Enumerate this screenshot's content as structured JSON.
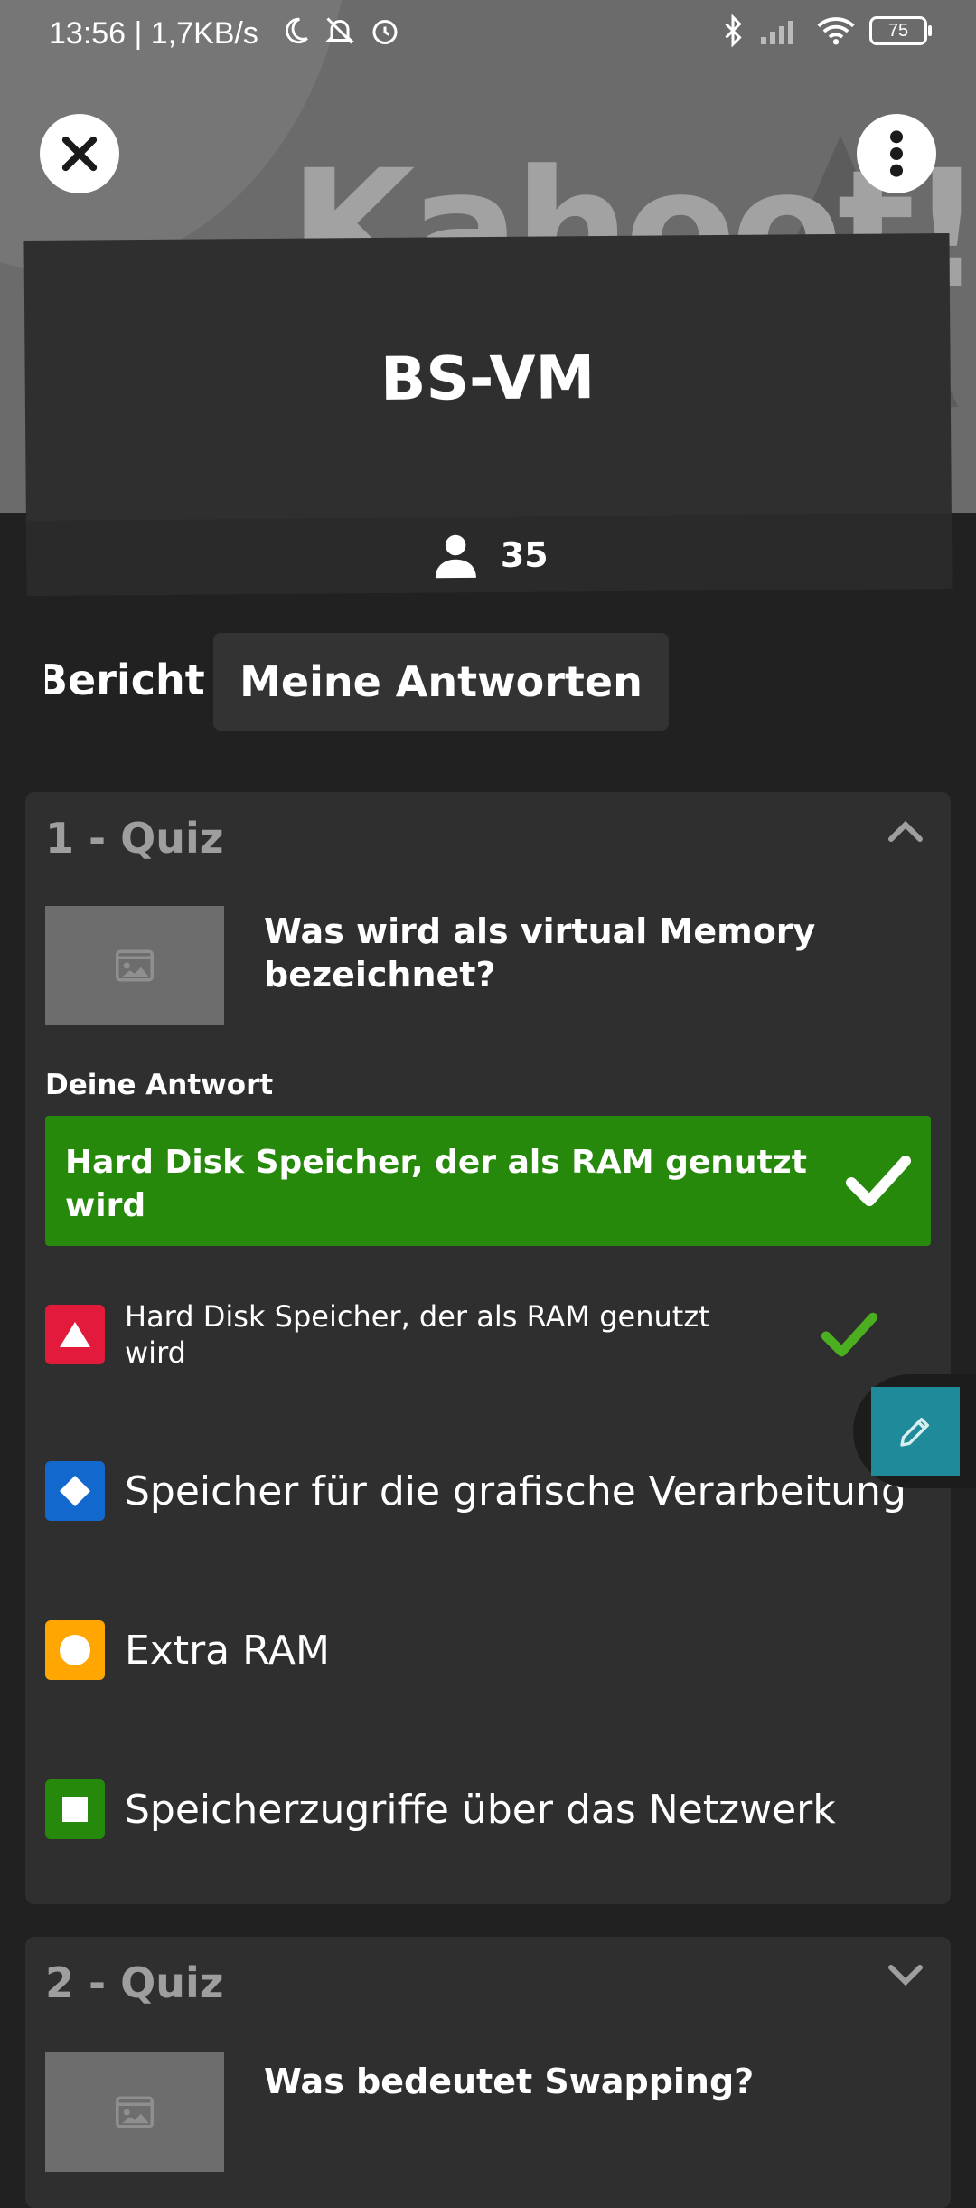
{
  "status_bar": {
    "time": "13:56 | 1,7KB/s",
    "battery": "75"
  },
  "header": {
    "logo_text": "Kahoot!",
    "title": "BS-VM",
    "player_count": "35"
  },
  "tabs": [
    {
      "label": "Bericht"
    },
    {
      "label": "Meine Antworten"
    }
  ],
  "questions": [
    {
      "header": "1 - Quiz",
      "question": "Was wird als virtual Memory bezeichnet?",
      "your_answer_label": "Deine Antwort",
      "your_answer": "Hard Disk Speicher, der als RAM genutzt wird",
      "options": [
        {
          "label": "Hard Disk Speicher, der als RAM genutzt wird",
          "color": "#e21b3c",
          "shape": "triangle-icon",
          "correct": true
        },
        {
          "label": "Speicher für die grafische Verarbeitung",
          "color": "#1368ce",
          "shape": "diamond-icon",
          "correct": false
        },
        {
          "label": "Extra RAM",
          "color": "#ffa602",
          "shape": "circle-icon",
          "correct": false
        },
        {
          "label": "Speicherzugriffe über das Netzwerk",
          "color": "#26890c",
          "shape": "square-icon",
          "correct": false
        }
      ]
    },
    {
      "header": "2 - Quiz",
      "question": "Was bedeutet Swapping?"
    }
  ],
  "colors": {
    "background": "#212121",
    "card": "#2f2f2f",
    "correct_green": "#26890c",
    "edit_teal": "#1f8a99"
  }
}
